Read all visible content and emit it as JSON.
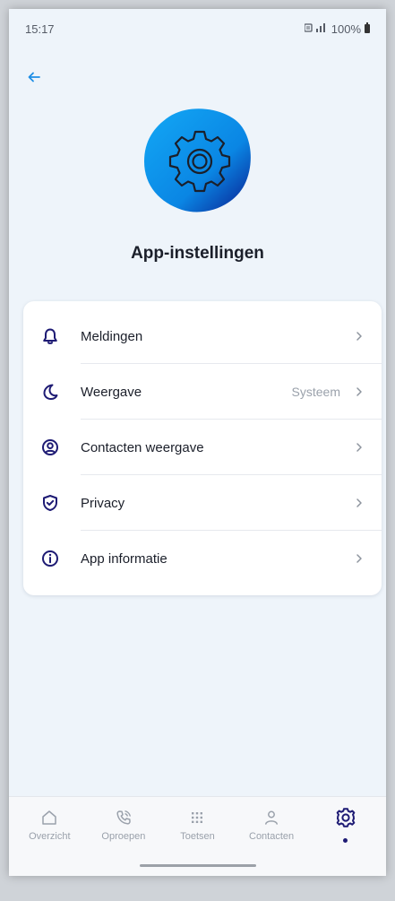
{
  "status_bar": {
    "time": "15:17",
    "signal": "⚡.❘❘",
    "battery": "100%"
  },
  "header": {
    "title": "App-instellingen"
  },
  "settings": {
    "items": [
      {
        "label": "Meldingen",
        "value": "",
        "icon": "bell-icon"
      },
      {
        "label": "Weergave",
        "value": "Systeem",
        "icon": "moon-icon"
      },
      {
        "label": "Contacten weergave",
        "value": "",
        "icon": "contact-circle-icon"
      },
      {
        "label": "Privacy",
        "value": "",
        "icon": "shield-check-icon"
      },
      {
        "label": "App informatie",
        "value": "",
        "icon": "info-icon"
      }
    ]
  },
  "bottom_nav": {
    "items": [
      {
        "label": "Overzicht",
        "icon": "home-icon"
      },
      {
        "label": "Oproepen",
        "icon": "phone-icon"
      },
      {
        "label": "Toetsen",
        "icon": "keypad-icon"
      },
      {
        "label": "Contacten",
        "icon": "person-icon"
      },
      {
        "label": "",
        "icon": "gear-icon",
        "active": true
      }
    ]
  },
  "colors": {
    "accent": "#1e1b74",
    "hero_blue": "#0a9bf0",
    "back_arrow": "#1f8ee6",
    "background": "#eef4fa"
  }
}
